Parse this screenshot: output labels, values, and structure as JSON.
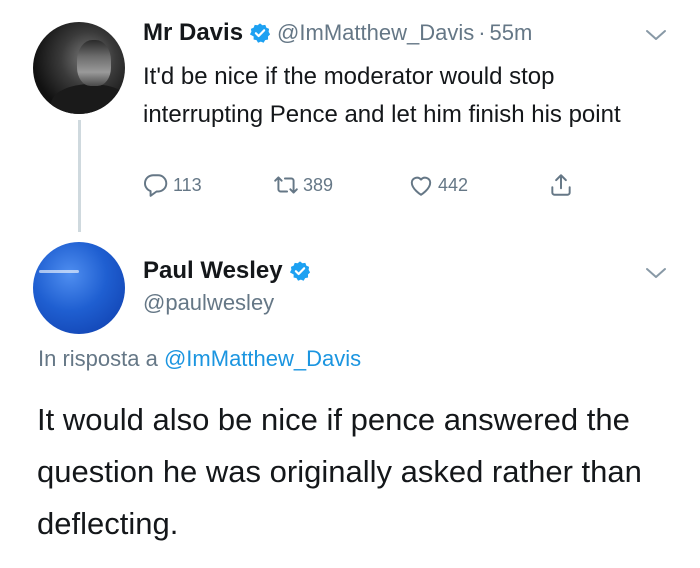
{
  "tweet1": {
    "name": "Mr Davis",
    "handle": "@ImMatthew_Davis",
    "separator": "·",
    "time": "55m",
    "text": "It'd be nice if the moderator would stop interrupting Pence and let him finish his point",
    "replies": "113",
    "retweets": "389",
    "likes": "442",
    "icons": [
      "verified-badge-icon",
      "chevron-down-icon",
      "reply-icon",
      "retweet-icon",
      "like-icon",
      "share-icon"
    ]
  },
  "tweet2": {
    "name": "Paul Wesley",
    "handle": "@paulwesley",
    "reply_prefix": "In risposta a",
    "reply_mention": "@ImMatthew_Davis",
    "text": "It would also be nice if pence answered the question he was originally asked rather than deflecting.",
    "icons": [
      "verified-badge-icon",
      "chevron-down-icon"
    ]
  },
  "colors": {
    "verified": "#1da1f2",
    "secondary_text": "#657786",
    "link": "#1b95e0",
    "thread_line": "#cfd9de"
  }
}
